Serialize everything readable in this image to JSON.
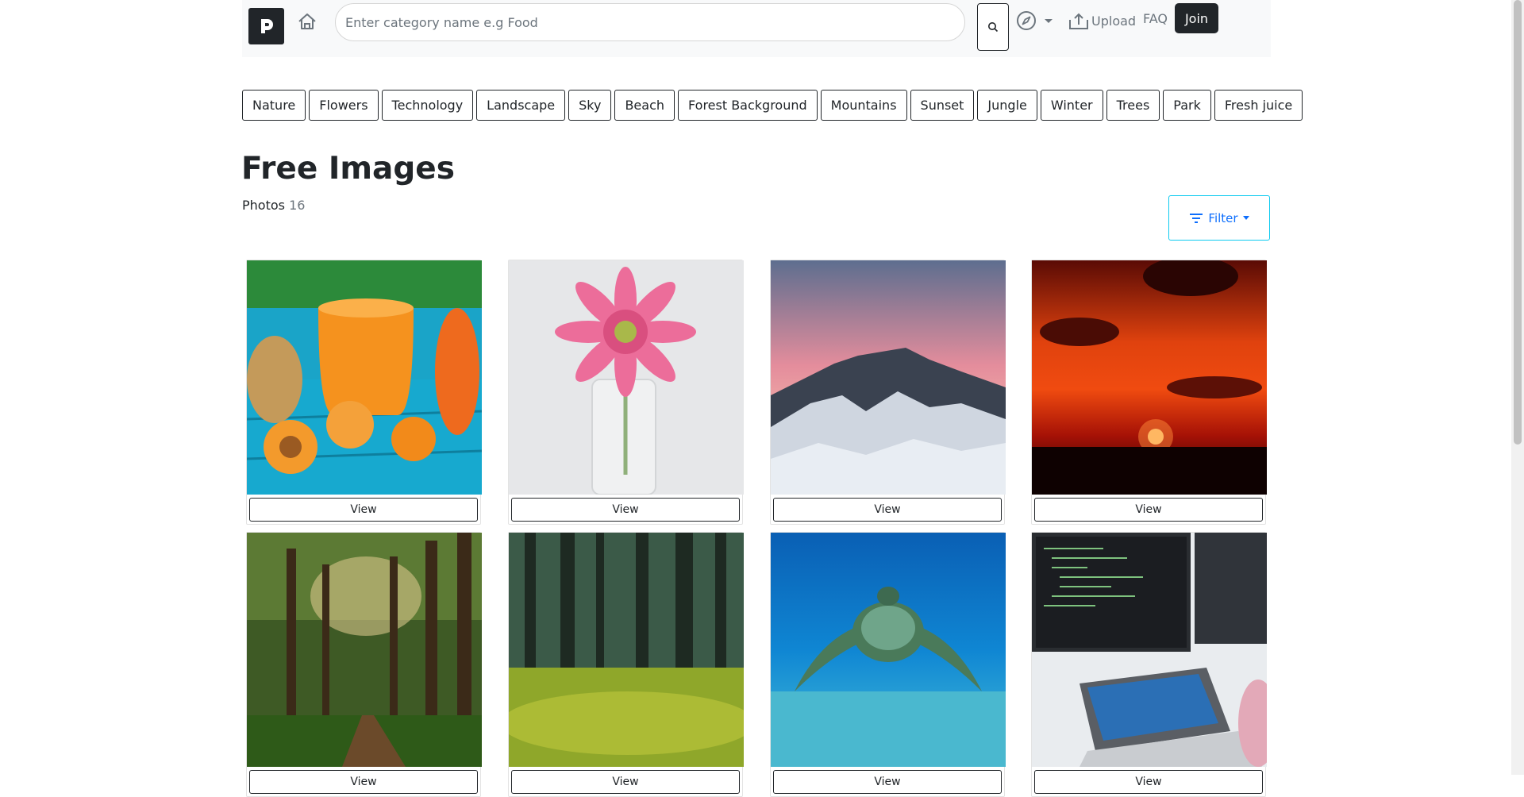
{
  "nav": {
    "search_placeholder": "Enter category name e.g Food",
    "upload_label": "Upload",
    "faq_label": "FAQ",
    "join_label": "Join"
  },
  "categories": [
    "Nature",
    "Flowers",
    "Technology",
    "Landscape",
    "Sky",
    "Beach",
    "Forest Background",
    "Mountains",
    "Sunset",
    "Jungle",
    "Winter",
    "Trees",
    "Park",
    "Fresh juice"
  ],
  "page": {
    "title": "Free Images",
    "photos_label": "Photos",
    "photos_count": "16",
    "filter_label": "Filter"
  },
  "cards": [
    {
      "view_label": "View",
      "image": "orange-juice-carrots-ginger"
    },
    {
      "view_label": "View",
      "image": "pink-gerbera-flower-in-vase"
    },
    {
      "view_label": "View",
      "image": "snowy-mountain-pink-sky"
    },
    {
      "view_label": "View",
      "image": "red-sunset-clouds"
    },
    {
      "view_label": "View",
      "image": "forest-path-sun-rays"
    },
    {
      "view_label": "View",
      "image": "pine-forest-moss"
    },
    {
      "view_label": "View",
      "image": "sea-turtle-underwater"
    },
    {
      "view_label": "View",
      "image": "person-coding-laptop-monitors"
    }
  ],
  "colors": {
    "dark": "#212529",
    "muted": "#6c757d",
    "accent": "#0d6efd",
    "filter_border": "#0dcaf0"
  }
}
